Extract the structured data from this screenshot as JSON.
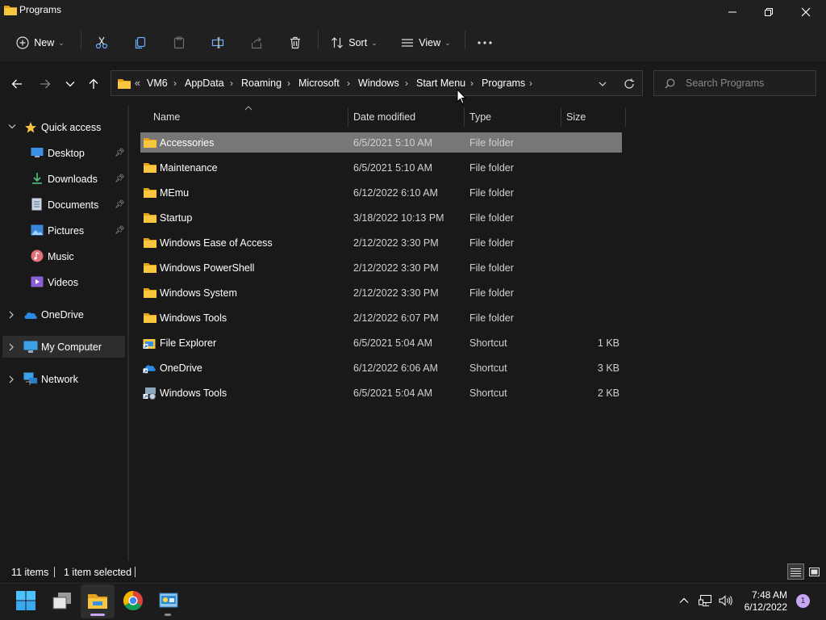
{
  "window": {
    "title": "Programs",
    "controls": {
      "minimize": "minimize",
      "maximize": "maximize",
      "close": "close"
    }
  },
  "toolbar": {
    "new_label": "New",
    "sort_label": "Sort",
    "view_label": "View"
  },
  "address": {
    "overflow": "«",
    "crumbs": [
      "VM6",
      "AppData",
      "Roaming",
      "Microsoft",
      "Windows",
      "Start Menu",
      "Programs"
    ],
    "separator": "›"
  },
  "search": {
    "placeholder": "Search Programs"
  },
  "navpane": {
    "quick_access": "Quick access",
    "items": [
      {
        "label": "Desktop",
        "icon": "desktop-icon",
        "pinned": true
      },
      {
        "label": "Downloads",
        "icon": "downloads-icon",
        "pinned": true
      },
      {
        "label": "Documents",
        "icon": "documents-icon",
        "pinned": true
      },
      {
        "label": "Pictures",
        "icon": "pictures-icon",
        "pinned": true
      },
      {
        "label": "Music",
        "icon": "music-icon",
        "pinned": false
      },
      {
        "label": "Videos",
        "icon": "videos-icon",
        "pinned": false
      }
    ],
    "onedrive": "OneDrive",
    "my_computer": "My Computer",
    "network": "Network"
  },
  "columns": {
    "name": "Name",
    "date": "Date modified",
    "type": "Type",
    "size": "Size"
  },
  "files": [
    {
      "name": "Accessories",
      "date": "6/5/2021 5:10 AM",
      "type": "File folder",
      "size": "",
      "kind": "folder",
      "selected": true
    },
    {
      "name": "Maintenance",
      "date": "6/5/2021 5:10 AM",
      "type": "File folder",
      "size": "",
      "kind": "folder"
    },
    {
      "name": "MEmu",
      "date": "6/12/2022 6:10 AM",
      "type": "File folder",
      "size": "",
      "kind": "folder"
    },
    {
      "name": "Startup",
      "date": "3/18/2022 10:13 PM",
      "type": "File folder",
      "size": "",
      "kind": "folder"
    },
    {
      "name": "Windows Ease of Access",
      "date": "2/12/2022 3:30 PM",
      "type": "File folder",
      "size": "",
      "kind": "folder"
    },
    {
      "name": "Windows PowerShell",
      "date": "2/12/2022 3:30 PM",
      "type": "File folder",
      "size": "",
      "kind": "folder"
    },
    {
      "name": "Windows System",
      "date": "2/12/2022 3:30 PM",
      "type": "File folder",
      "size": "",
      "kind": "folder"
    },
    {
      "name": "Windows Tools",
      "date": "2/12/2022 6:07 PM",
      "type": "File folder",
      "size": "",
      "kind": "folder"
    },
    {
      "name": "File Explorer",
      "date": "6/5/2021 5:04 AM",
      "type": "Shortcut",
      "size": "1 KB",
      "kind": "explorer-shortcut"
    },
    {
      "name": "OneDrive",
      "date": "6/12/2022 6:06 AM",
      "type": "Shortcut",
      "size": "3 KB",
      "kind": "onedrive-shortcut"
    },
    {
      "name": "Windows Tools",
      "date": "6/5/2021 5:04 AM",
      "type": "Shortcut",
      "size": "2 KB",
      "kind": "tools-shortcut"
    }
  ],
  "status": {
    "items": "11 items",
    "selected": "1 item selected"
  },
  "taskbar": {
    "time": "7:48 AM",
    "date": "6/12/2022",
    "notifications": "1"
  },
  "colors": {
    "folder": "#f8c63f",
    "accent": "#60cdff",
    "selected_row": "#777777",
    "background": "#191919"
  }
}
